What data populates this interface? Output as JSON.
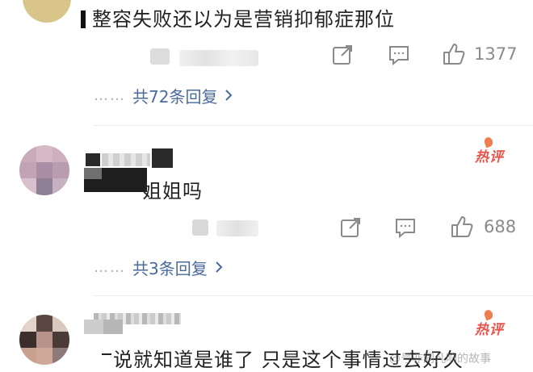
{
  "comments": [
    {
      "text": "整容失败还以为是营销抑郁症那位",
      "share_icon": "share-edit-icon",
      "comment_icon": "comment-icon",
      "like_icon": "thumbs-up-icon",
      "likes": "1377",
      "replies": "共72条回复"
    },
    {
      "text": "姐姐吗",
      "hot_label": "热评",
      "likes": "688",
      "replies": "共3条回复"
    },
    {
      "text": "说就知道是谁了 只是这个事情过去好久",
      "hot_label": "热评"
    }
  ],
  "watermark": "@号非同凡响的故事",
  "colors": {
    "link": "#4a6a9b",
    "hot": "#e8534b",
    "icon": "#8a8a8a"
  }
}
